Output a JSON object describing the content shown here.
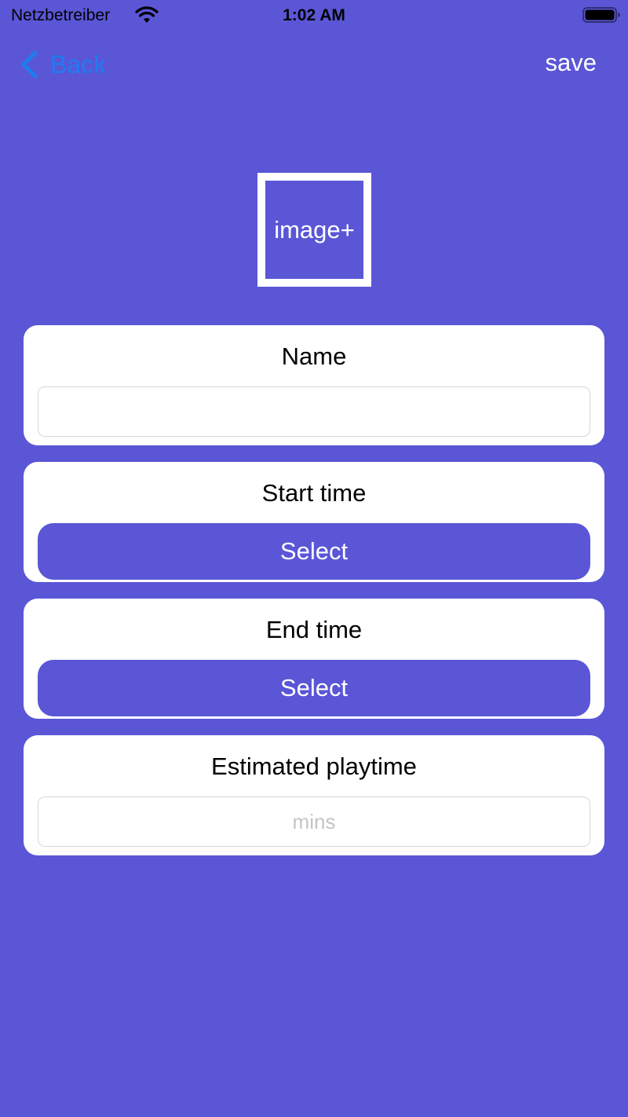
{
  "status_bar": {
    "carrier": "Netzbetreiber",
    "time": "1:02 AM",
    "icons": [
      "wifi-icon",
      "battery-icon"
    ]
  },
  "nav": {
    "back_label": "Back",
    "back_icon": "chevron-left-icon",
    "save_label": "save"
  },
  "image_picker": {
    "label": "image+"
  },
  "form": {
    "name": {
      "label": "Name",
      "value": "",
      "placeholder": ""
    },
    "start_time": {
      "label": "Start time",
      "button_label": "Select"
    },
    "end_time": {
      "label": "End time",
      "button_label": "Select"
    },
    "playtime": {
      "label": "Estimated playtime",
      "value": "",
      "placeholder": "mins"
    }
  },
  "colors": {
    "background": "#5a56d6",
    "card": "#ffffff",
    "back_link": "#1f7cf0",
    "select_button": "#5a56d6"
  }
}
